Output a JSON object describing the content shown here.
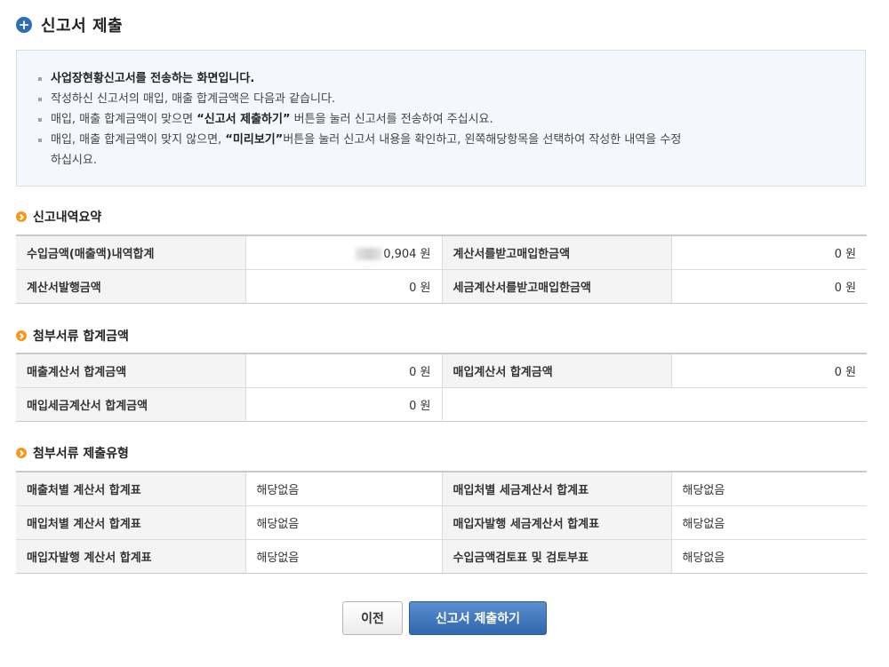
{
  "header": {
    "title": "신고서 제출"
  },
  "notice": {
    "line1": "사업장현황신고서를 전송하는 화면입니다.",
    "line2": "작성하신 신고서의 매입, 매출 합계금액은 다음과 같습니다.",
    "line3_pre": "매입, 매출 합계금액이 맞으면 ",
    "line3_bold": "“신고서 제출하기”",
    "line3_post": " 버튼을 눌러 신고서를 전송하여 주십시요.",
    "line4_pre": "매입, 매출 합계금액이 맞지 않으면, ",
    "line4_bold": "“미리보기”",
    "line4_post": "버튼을 눌러 신고서 내용을 확인하고, 왼쪽해당항목을 선택하여 작성한 내역을 수정",
    "line4_cont": "하십시요."
  },
  "summary": {
    "title": "신고내역요약",
    "rows": [
      {
        "label1": "수입금액(매출액)내역합계",
        "value1": "0,904 원",
        "label2": "계산서를받고매입한금액",
        "value2": "0 원"
      },
      {
        "label1": "계산서발행금액",
        "value1": "0 원",
        "label2": "세금계산서를받고매입한금액",
        "value2": "0 원"
      }
    ]
  },
  "attach_total": {
    "title": "첨부서류 합계금액",
    "rows": [
      {
        "label1": "매출계산서 합계금액",
        "value1": "0 원",
        "label2": "매입계산서 합계금액",
        "value2": "0 원"
      },
      {
        "label1": "매입세금계산서 합계금액",
        "value1": "0 원",
        "label2": "",
        "value2": ""
      }
    ]
  },
  "attach_type": {
    "title": "첨부서류 제출유형",
    "rows": [
      {
        "label1": "매출처별 계산서 합계표",
        "value1": "해당없음",
        "label2": "매입처별 세금계산서 합계표",
        "value2": "해당없음"
      },
      {
        "label1": "매입처별 계산서 합계표",
        "value1": "해당없음",
        "label2": "매입자발행 세금계산서 합계표",
        "value2": "해당없음"
      },
      {
        "label1": "매입자발행 계산서 합계표",
        "value1": "해당없음",
        "label2": "수입금액검토표 및 검토부표",
        "value2": "해당없음"
      }
    ]
  },
  "buttons": {
    "prev": "이전",
    "submit": "신고서 제출하기"
  },
  "colors": {
    "accent": "#2f66ad",
    "bullet": "#f39a1e",
    "notice_bg": "#f4f7fb"
  }
}
